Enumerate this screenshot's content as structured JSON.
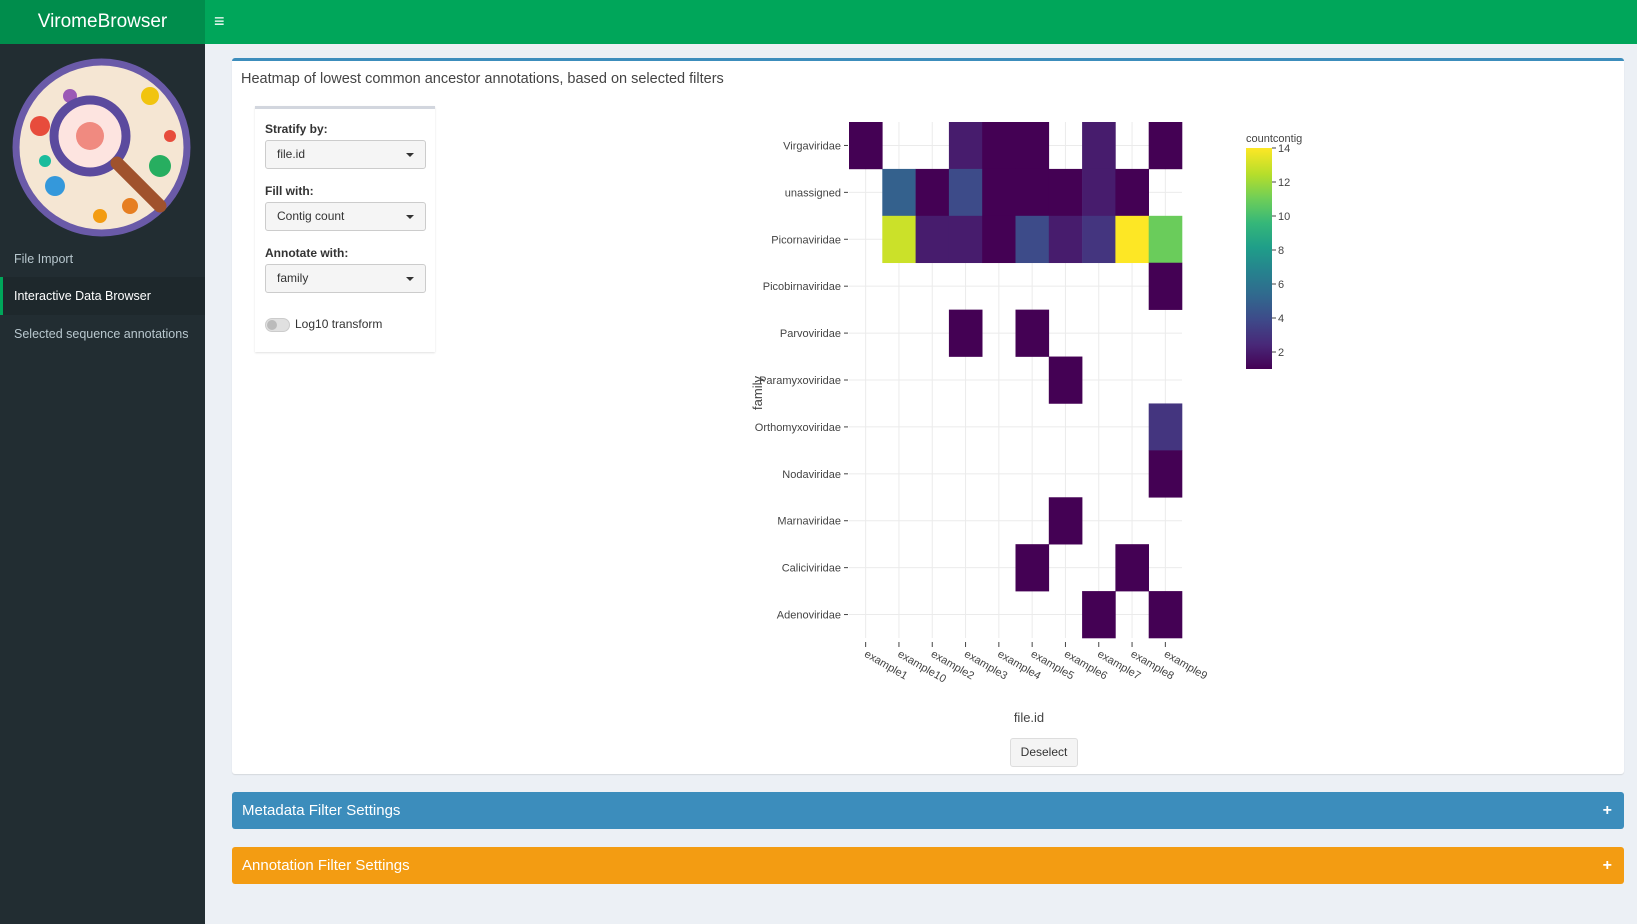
{
  "app": {
    "title": "ViromeBrowser"
  },
  "sidebar": {
    "items": [
      {
        "label": "File Import"
      },
      {
        "label": "Interactive Data Browser"
      },
      {
        "label": "Selected sequence annotations"
      }
    ]
  },
  "main_box": {
    "title": "Heatmap of lowest common ancestor annotations, based on selected filters",
    "controls": {
      "stratify_label": "Stratify by:",
      "stratify_value": "file.id",
      "fill_label": "Fill with:",
      "fill_value": "Contig count",
      "annotate_label": "Annotate with:",
      "annotate_value": "family",
      "log_label": "Log10 transform",
      "log_enabled": false
    },
    "deselect_label": "Deselect"
  },
  "panels": {
    "metadata_title": "Metadata Filter Settings",
    "annotation_title": "Annotation Filter Settings",
    "expand_symbol": "+"
  },
  "chart_data": {
    "type": "heatmap",
    "xlabel": "file.id",
    "ylabel": "family",
    "legend_title": "countcontig",
    "colorbar_ticks": [
      2,
      4,
      6,
      8,
      10,
      12,
      14
    ],
    "value_range": [
      1,
      14
    ],
    "colorscale": [
      "#440154",
      "#482878",
      "#3e4989",
      "#31688e",
      "#26828e",
      "#1f9e89",
      "#35b779",
      "#6ece58",
      "#b5de2b",
      "#fde725"
    ],
    "x": [
      "example1",
      "example10",
      "example2",
      "example3",
      "example4",
      "example5",
      "example6",
      "example7",
      "example8",
      "example9"
    ],
    "y": [
      "Virgaviridae",
      "unassigned",
      "Picornaviridae",
      "Picobirnaviridae",
      "Parvoviridae",
      "Paramyxoviridae",
      "Orthomyxoviridae",
      "Nodaviridae",
      "Marnaviridae",
      "Caliciviridae",
      "Adenoviridae"
    ],
    "z": [
      [
        1,
        null,
        null,
        2,
        1,
        1,
        null,
        2,
        null,
        1
      ],
      [
        null,
        5,
        1,
        4,
        1,
        1,
        1,
        2,
        1,
        null
      ],
      [
        null,
        13,
        2,
        2,
        1,
        4,
        2,
        3,
        14,
        11
      ],
      [
        null,
        null,
        null,
        null,
        null,
        null,
        null,
        null,
        null,
        1
      ],
      [
        null,
        null,
        null,
        1,
        null,
        1,
        null,
        null,
        null,
        null
      ],
      [
        null,
        null,
        null,
        null,
        null,
        null,
        1,
        null,
        null,
        null
      ],
      [
        null,
        null,
        null,
        null,
        null,
        null,
        null,
        null,
        null,
        3
      ],
      [
        null,
        null,
        null,
        null,
        null,
        null,
        null,
        null,
        null,
        1
      ],
      [
        null,
        null,
        null,
        null,
        null,
        null,
        1,
        null,
        null,
        null
      ],
      [
        null,
        null,
        null,
        null,
        null,
        1,
        null,
        null,
        1,
        null
      ],
      [
        null,
        null,
        null,
        null,
        null,
        null,
        null,
        1,
        null,
        1
      ]
    ]
  }
}
